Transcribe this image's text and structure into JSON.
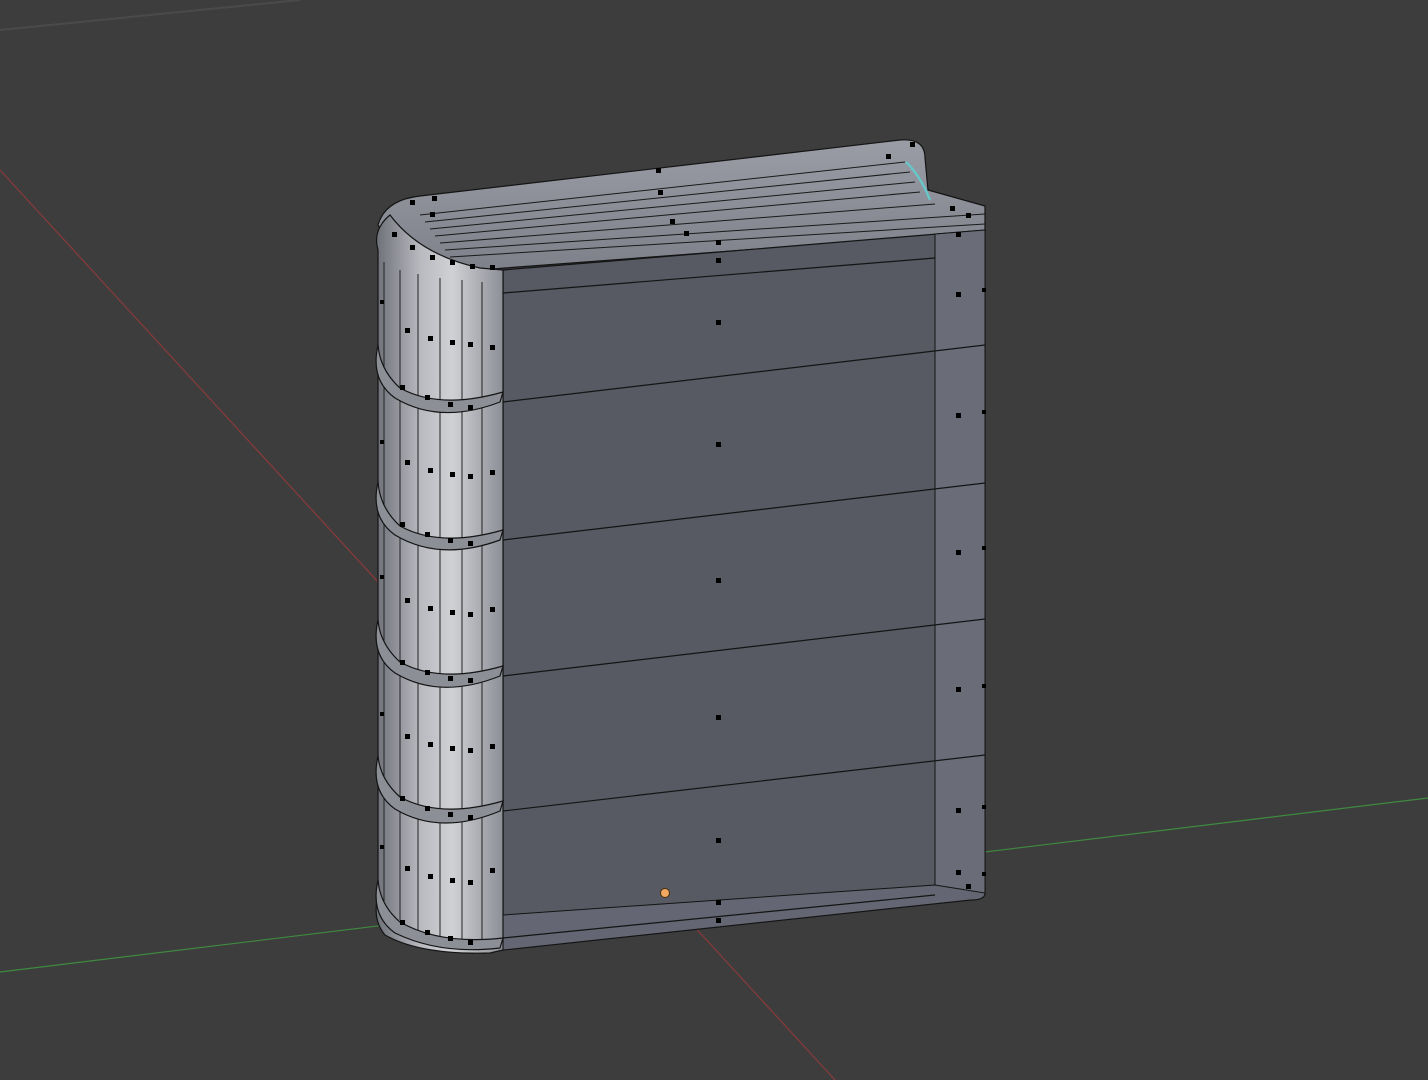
{
  "viewport": {
    "background": "#3d3d3d",
    "grid_line_color": "#4a4a4a",
    "x_axis_color": "#8a3a3a",
    "y_axis_color": "#3f8a3f"
  },
  "book_mesh": {
    "mode": "edit",
    "cover_color": "#575a63",
    "cover_edge_color": "#686b76",
    "spine_color": "#9a9ca3",
    "spine_highlight_color": "#c9cacd",
    "page_block_color": "#8c8e98",
    "wire_color": "#141414",
    "vertex_color": "#000000",
    "selected_edge_color": "#67c6c8",
    "spine_bands": 5
  },
  "object_origin": {
    "color": "#f2a860"
  }
}
